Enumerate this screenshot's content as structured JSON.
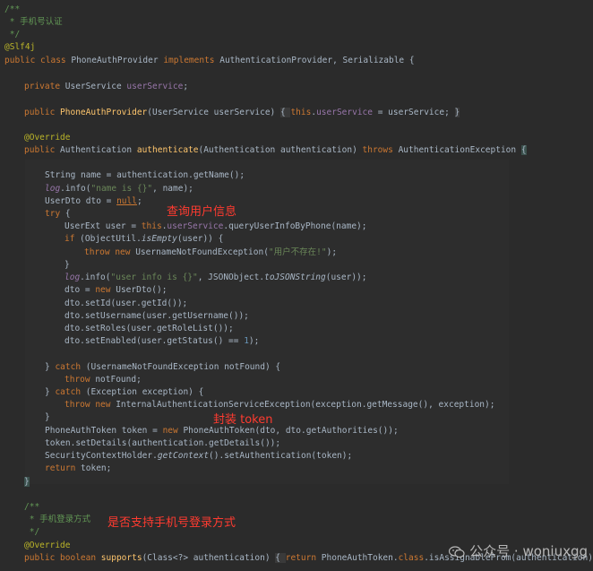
{
  "code_lines": [
    "/**",
    " * 手机号认证",
    " */",
    "@Slf4j",
    "public class PhoneAuthProvider implements AuthenticationProvider, Serializable {",
    "private UserService userService;",
    "public PhoneAuthProvider(UserService userService) { this.userService = userService; }",
    "@Override",
    "public Authentication authenticate(Authentication authentication) throws AuthenticationException {",
    "String name = authentication.getName();",
    "log.info(\"name is {}\", name);",
    "UserDto dto = null;",
    "try {",
    "UserExt user = this.userService.queryUserInfoByPhone(name);",
    "if (ObjectUtil.isEmpty(user)) {",
    "throw new UsernameNotFoundException(\"用户不存在!\");",
    "}",
    "log.info(\"user info is {}\", JSONObject.toJSONString(user));",
    "dto = new UserDto();",
    "dto.setId(user.getId());",
    "dto.setUsername(user.getUsername());",
    "dto.setRoles(user.getRoleList());",
    "dto.setEnabled(user.getStatus() == 1);",
    "} catch (UsernameNotFoundException notFound) {",
    "throw notFound;",
    "} catch (Exception exception) {",
    "throw new InternalAuthenticationServiceException(exception.getMessage(), exception);",
    "}",
    "PhoneAuthToken token = new PhoneAuthToken(dto, dto.getAuthorities());",
    "token.setDetails(authentication.getDetails());",
    "SecurityContextHolder.getContext().setAuthentication(token);",
    "return token;",
    "}",
    "/**",
    " * 手机登录方式",
    " */",
    "@Override",
    "public boolean supports(Class<?> authentication) { return PhoneAuthToken.class.isAssignableFrom(authentication); }"
  ],
  "annotations": {
    "query_user": "查询用户信息",
    "wrap_token": "封装 token",
    "supports_phone": "是否支持手机号登录方式"
  },
  "watermark": "公众号 · woniuxgg",
  "colors": {
    "background": "#2b2b2b",
    "keyword": "#cc7832",
    "field": "#9876aa",
    "method": "#ffc66d",
    "string": "#6a8759",
    "annotation": "#bbb529",
    "comment": "#629755",
    "note_red": "#ff3b30"
  }
}
